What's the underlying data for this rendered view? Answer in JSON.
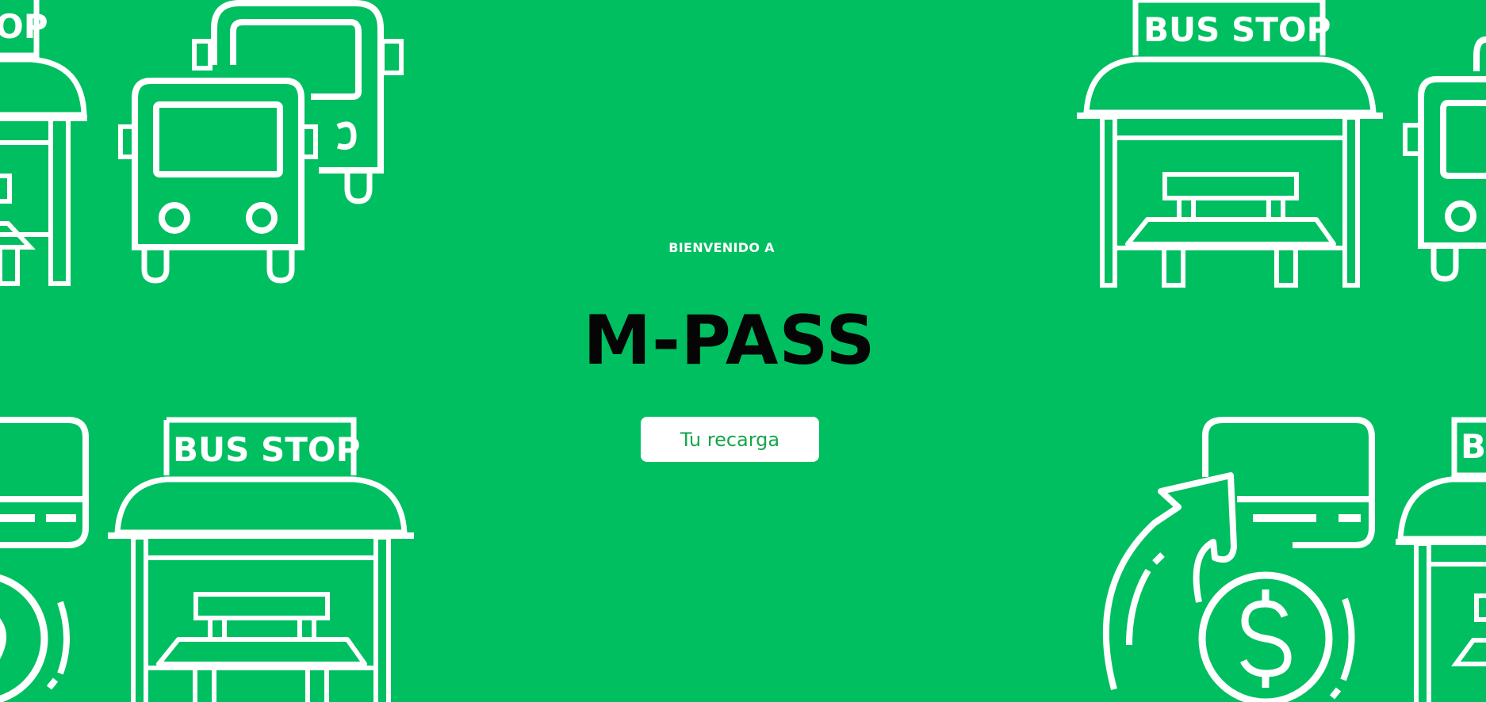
{
  "hero": {
    "welcome": "BIENVENIDO A",
    "title": "M-PASS",
    "cta_label": "Tu recarga"
  },
  "background": {
    "sign_text": "BUS STOP",
    "sign_partial_left": "OP",
    "sign_partial_right": "BU",
    "icons": [
      "bus-stop-icon",
      "double-bus-icon",
      "bus-icon",
      "card-recharge-icon"
    ]
  },
  "colors": {
    "background": "#00bf60",
    "icon_stroke": "#ffffff",
    "title": "#050505",
    "cta_text": "#16a64a"
  }
}
